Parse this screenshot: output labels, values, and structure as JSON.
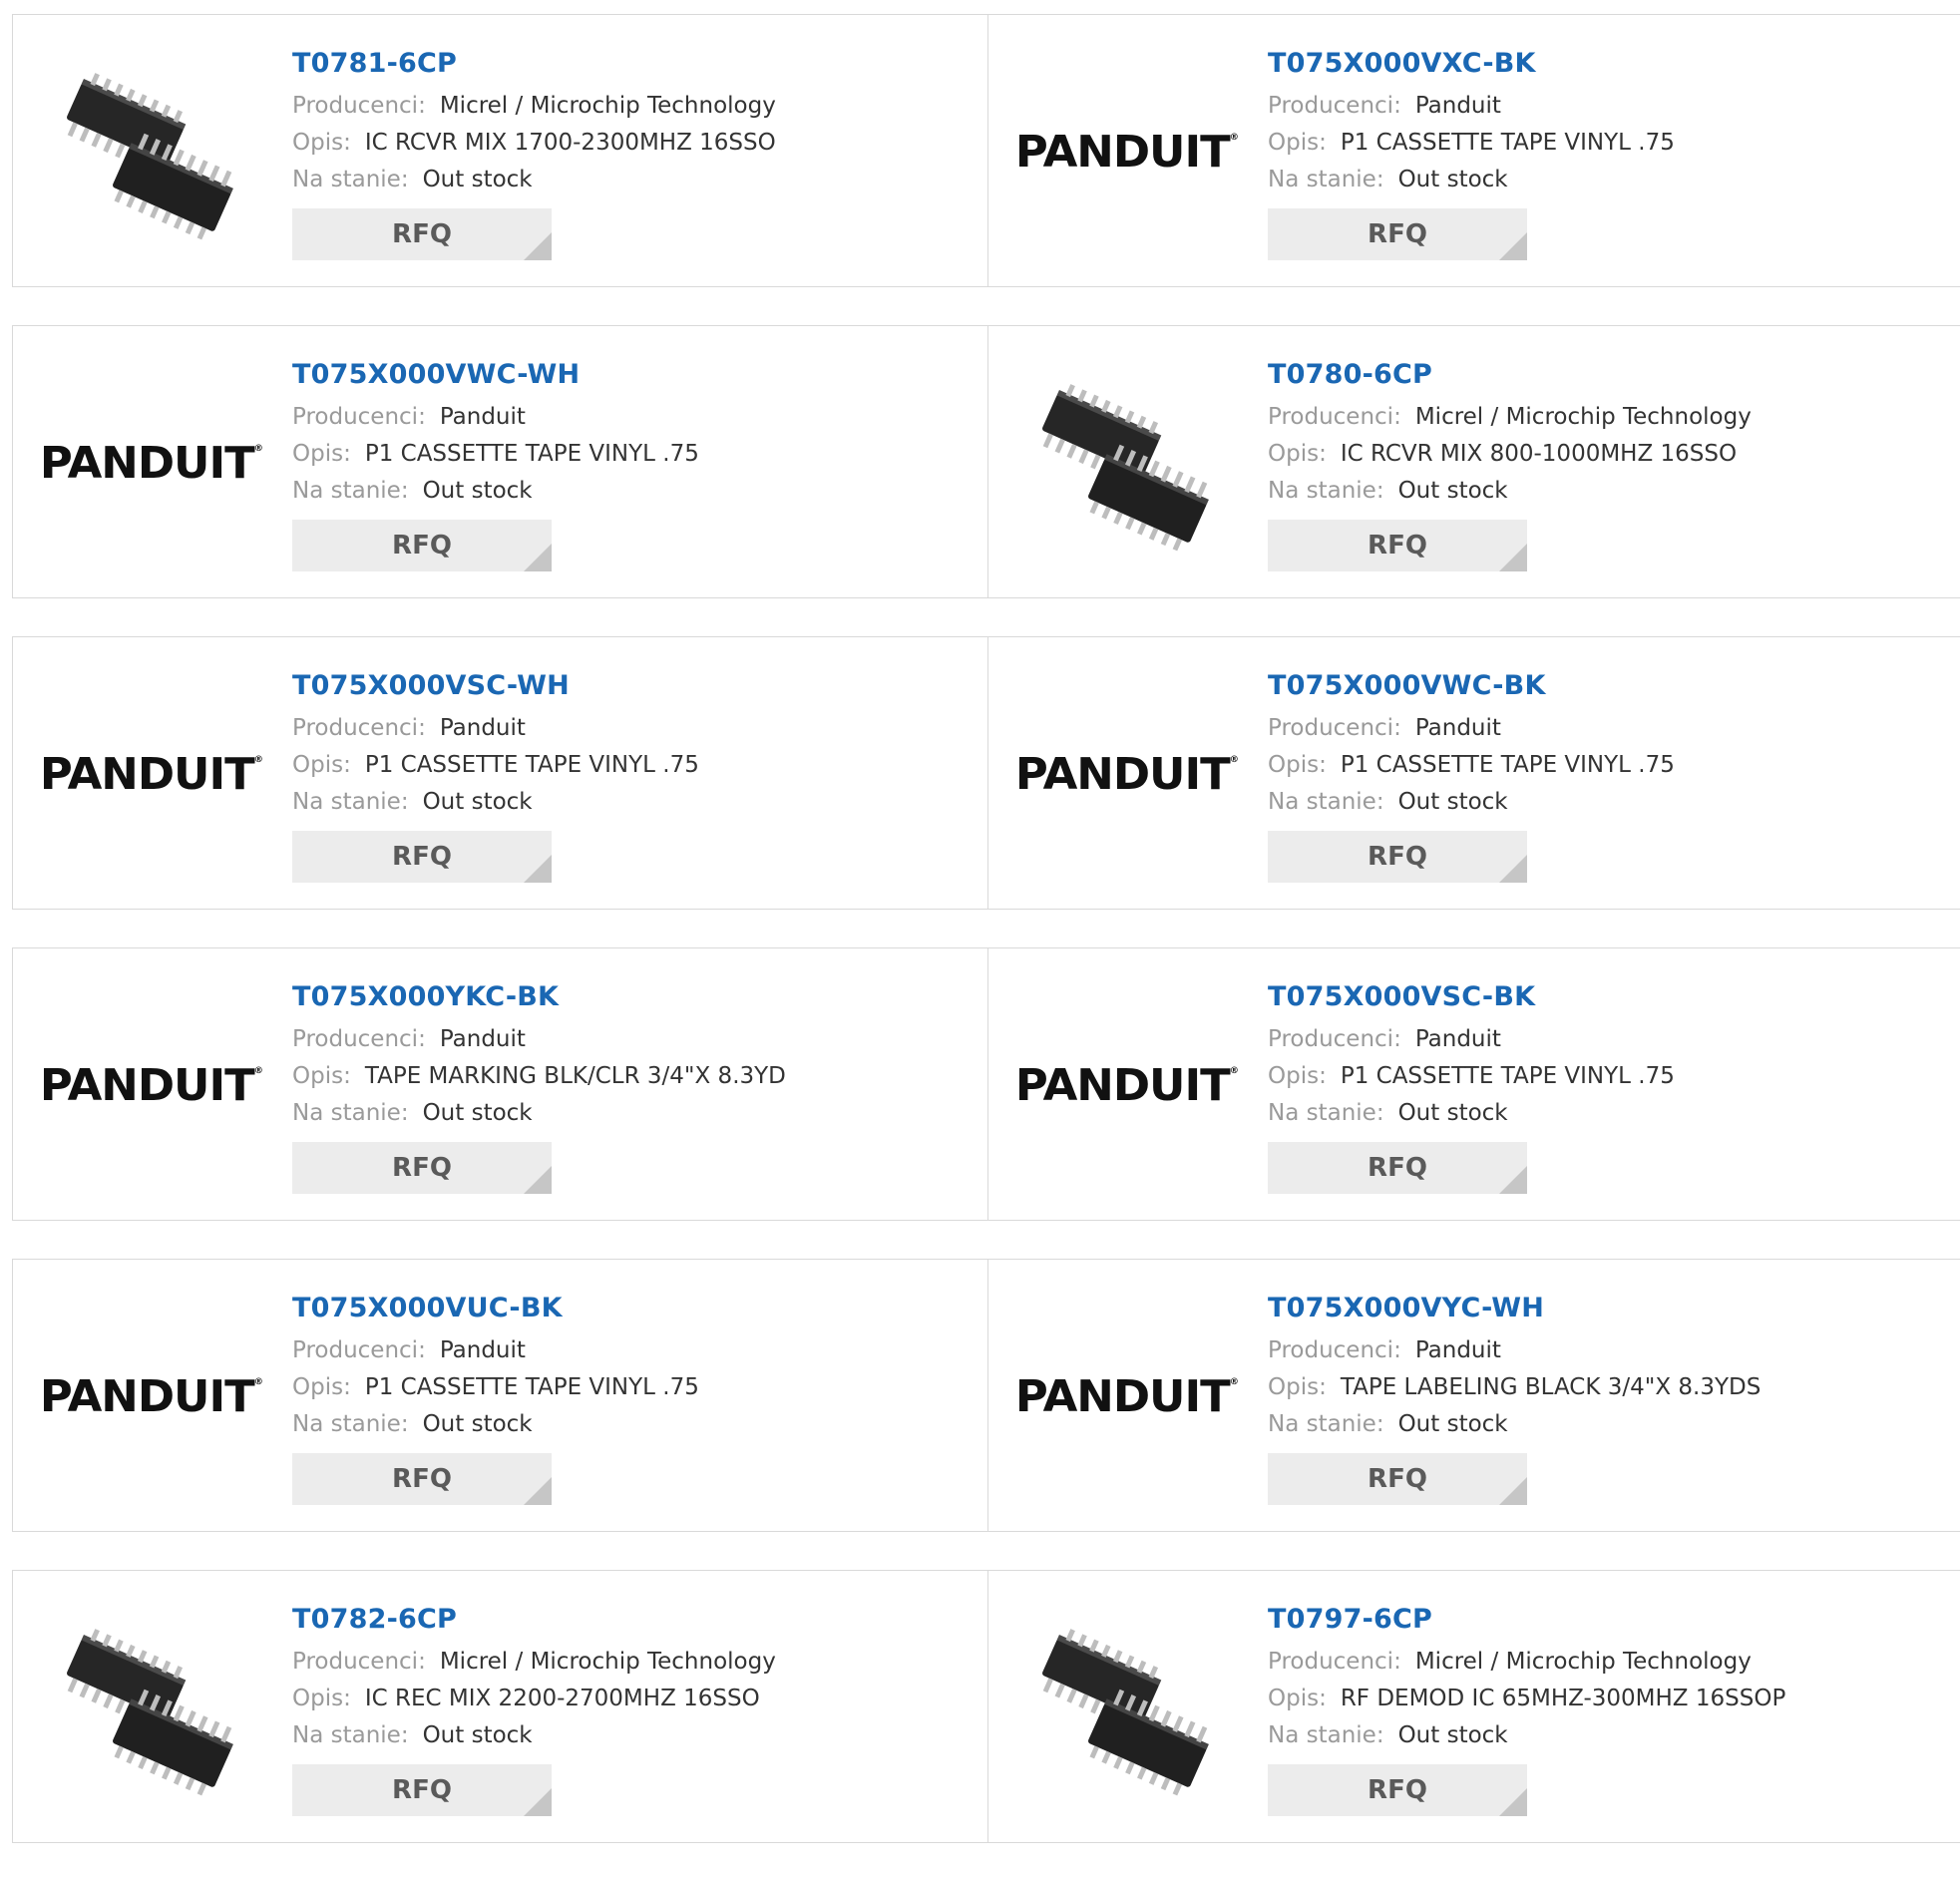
{
  "labels": {
    "manufacturer": "Producenci:",
    "description": "Opis:",
    "stock": "Na stanie:",
    "rfq": "RFQ"
  },
  "products": [
    {
      "part": "T0781-6CP",
      "manufacturer": "Micrel / Microchip Technology",
      "description": "IC RCVR MIX 1700-2300MHZ 16SSO",
      "stock": "Out stock",
      "image": "chip-icon"
    },
    {
      "part": "T075X000VXC-BK",
      "manufacturer": "Panduit",
      "description": "P1 CASSETTE TAPE VINYL .75",
      "stock": "Out stock",
      "image": "panduit-logo"
    },
    {
      "part": "T075X000VWC-WH",
      "manufacturer": "Panduit",
      "description": "P1 CASSETTE TAPE VINYL .75",
      "stock": "Out stock",
      "image": "panduit-logo"
    },
    {
      "part": "T0780-6CP",
      "manufacturer": "Micrel / Microchip Technology",
      "description": "IC RCVR MIX 800-1000MHZ 16SSO",
      "stock": "Out stock",
      "image": "chip-icon"
    },
    {
      "part": "T075X000VSC-WH",
      "manufacturer": "Panduit",
      "description": "P1 CASSETTE TAPE VINYL .75",
      "stock": "Out stock",
      "image": "panduit-logo"
    },
    {
      "part": "T075X000VWC-BK",
      "manufacturer": "Panduit",
      "description": "P1 CASSETTE TAPE VINYL .75",
      "stock": "Out stock",
      "image": "panduit-logo"
    },
    {
      "part": "T075X000YKC-BK",
      "manufacturer": "Panduit",
      "description": "TAPE MARKING BLK/CLR 3/4\"X 8.3YD",
      "stock": "Out stock",
      "image": "panduit-logo"
    },
    {
      "part": "T075X000VSC-BK",
      "manufacturer": "Panduit",
      "description": "P1 CASSETTE TAPE VINYL .75",
      "stock": "Out stock",
      "image": "panduit-logo"
    },
    {
      "part": "T075X000VUC-BK",
      "manufacturer": "Panduit",
      "description": "P1 CASSETTE TAPE VINYL .75",
      "stock": "Out stock",
      "image": "panduit-logo"
    },
    {
      "part": "T075X000VYC-WH",
      "manufacturer": "Panduit",
      "description": "TAPE LABELING BLACK 3/4\"X 8.3YDS",
      "stock": "Out stock",
      "image": "panduit-logo"
    },
    {
      "part": "T0782-6CP",
      "manufacturer": "Micrel / Microchip Technology",
      "description": "IC REC MIX 2200-2700MHZ 16SSO",
      "stock": "Out stock",
      "image": "chip-icon"
    },
    {
      "part": "T0797-6CP",
      "manufacturer": "Micrel / Microchip Technology",
      "description": "RF DEMOD IC 65MHZ-300MHZ 16SSOP",
      "stock": "Out stock",
      "image": "chip-icon"
    }
  ],
  "logo_text": "PANDUIT",
  "colors": {
    "link": "#1a67b3",
    "label": "#9a9a9a",
    "button_bg": "#ececec",
    "border": "#d9d9d9"
  }
}
